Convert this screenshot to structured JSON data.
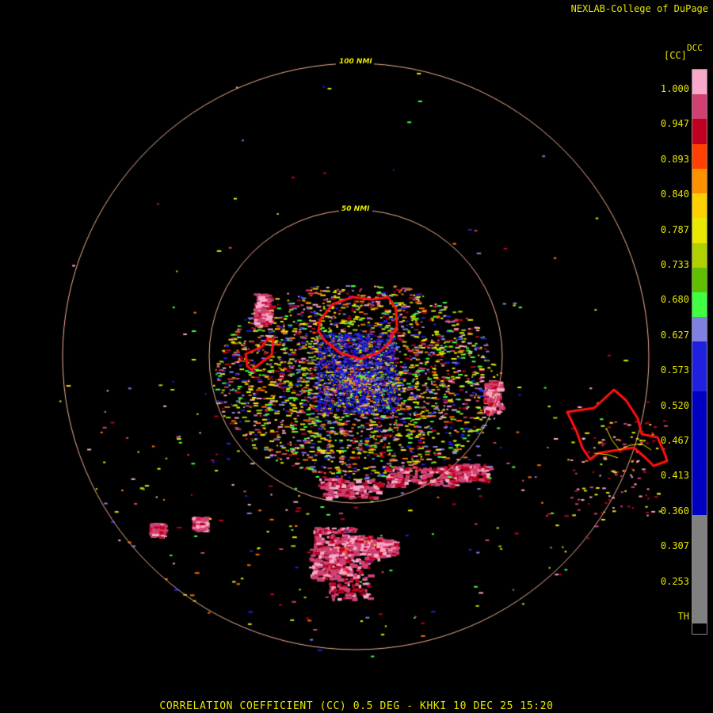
{
  "header": {
    "credit": "NEXLAB-College of DuPage",
    "product_code": "DCC",
    "unit_label": "[CC]"
  },
  "footer": {
    "title": "CORRELATION COEFFICIENT (CC) 0.5 DEG - KHKI 10 DEC 25 15:20"
  },
  "range_rings": [
    {
      "label": "100 NMI"
    },
    {
      "label": "50 NMI"
    }
  ],
  "legend": {
    "ticks": [
      "1.000",
      "0.947",
      "0.893",
      "0.840",
      "0.787",
      "0.733",
      "0.680",
      "0.627",
      "0.573",
      "0.520",
      "0.467",
      "0.413",
      "0.360",
      "0.307",
      "0.253",
      "TH"
    ],
    "colors": [
      "#f8a8c8",
      "#d04070",
      "#c00020",
      "#ff4000",
      "#ff9000",
      "#ffd000",
      "#e8e800",
      "#b0d000",
      "#60c000",
      "#40ff40",
      "#8080e0",
      "#2020e0",
      "#0000c0",
      "#808080",
      "#000000"
    ]
  },
  "map_colors": {
    "ring": "#f0b090",
    "county_outline": "#ff1010",
    "coast_trace": "#e8e800"
  }
}
